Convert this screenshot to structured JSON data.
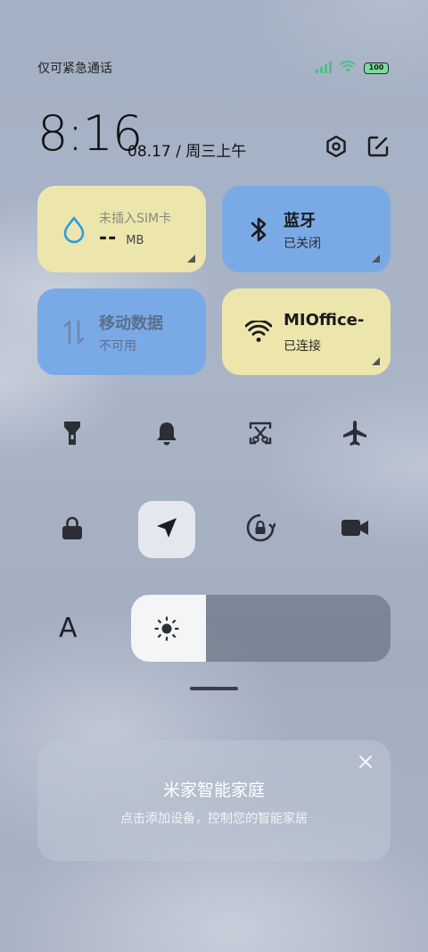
{
  "status_bar": {
    "carrier_text": "仅可紧急通话",
    "battery_level": "100",
    "icons": [
      "signal-icon",
      "wifi-icon",
      "battery-icon"
    ]
  },
  "header": {
    "time": "8:16",
    "date": "08.17 / 周三上午",
    "icons": [
      "settings-icon",
      "edit-icon"
    ]
  },
  "tiles": [
    {
      "name": "data-usage",
      "title": "未插入SIM卡",
      "value": "--",
      "unit": "MB",
      "color": "#ece6ad",
      "icon": "water-drop-icon"
    },
    {
      "name": "bluetooth",
      "title": "蓝牙",
      "sub": "已关闭",
      "color": "#7aaae6",
      "icon": "bluetooth-icon"
    },
    {
      "name": "mobile-data",
      "title": "移动数据",
      "sub": "不可用",
      "color": "#7aaae6",
      "icon": "mobile-data-icon"
    },
    {
      "name": "wifi",
      "title": "MIOffice-",
      "sub": "已连接",
      "color": "#ece6ad",
      "icon": "wifi-icon"
    }
  ],
  "toggles": [
    {
      "name": "flashlight",
      "icon": "flashlight-icon",
      "active": false
    },
    {
      "name": "silent",
      "icon": "bell-icon",
      "active": false
    },
    {
      "name": "screenshot",
      "icon": "screenshot-icon",
      "active": false
    },
    {
      "name": "airplane",
      "icon": "airplane-icon",
      "active": false
    },
    {
      "name": "lock-screen",
      "icon": "lock-icon",
      "active": false
    },
    {
      "name": "location",
      "icon": "location-arrow-icon",
      "active": true
    },
    {
      "name": "rotation-lock",
      "icon": "rotation-lock-icon",
      "active": false
    },
    {
      "name": "screen-record",
      "icon": "video-camera-icon",
      "active": false
    }
  ],
  "brightness": {
    "level": 0.29,
    "auto_label": "A"
  },
  "smart_home": {
    "title": "米家智能家庭",
    "subtitle": "点击添加设备，控制您的智能家居"
  }
}
